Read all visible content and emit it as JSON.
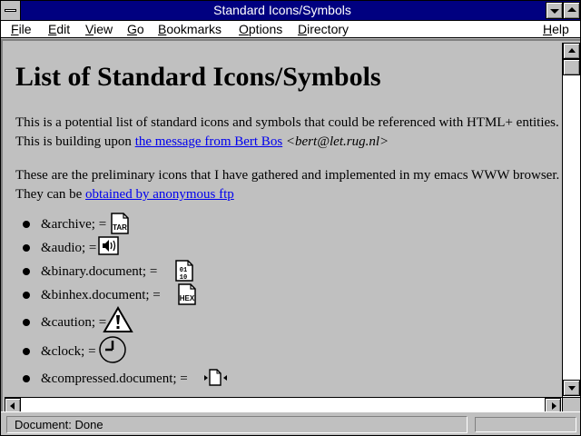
{
  "window": {
    "title": "Standard Icons/Symbols"
  },
  "menu": {
    "items": [
      {
        "label": "File",
        "key": "F",
        "rest": "ile"
      },
      {
        "label": "Edit",
        "key": "E",
        "rest": "dit"
      },
      {
        "label": "View",
        "key": "V",
        "rest": "iew"
      },
      {
        "label": "Go",
        "key": "G",
        "rest": "o"
      },
      {
        "label": "Bookmarks",
        "key": "B",
        "rest": "ookmarks"
      },
      {
        "label": "Options",
        "key": "O",
        "rest": "ptions"
      },
      {
        "label": "Directory",
        "key": "D",
        "rest": "irectory"
      },
      {
        "label": "Help",
        "key": "H",
        "rest": "elp"
      }
    ]
  },
  "page": {
    "heading": "List of Standard Icons/Symbols",
    "intro": {
      "text1": "This is a potential list of standard icons and symbols that could be referenced with HTML+ entities. This is building upon ",
      "link": "the message from Bert Bos",
      "email": "<bert@let.rug.nl>"
    },
    "prelim": {
      "text1": "These are the preliminary icons that I have gathered and implemented in my emacs WWW browser. They can be ",
      "link": "obtained by anonymous ftp"
    },
    "entities": [
      {
        "label": "&archive; =",
        "icon": "archive-icon",
        "icon_text": "TAR"
      },
      {
        "label": "&audio; =",
        "icon": "audio-icon"
      },
      {
        "label": "&binary.document; =",
        "icon": "binary-document-icon",
        "icon_text": "01 10"
      },
      {
        "label": "&binhex.document; =",
        "icon": "binhex-document-icon",
        "icon_text": "HEX"
      },
      {
        "label": "&caution; =",
        "icon": "caution-icon"
      },
      {
        "label": "&clock; =",
        "icon": "clock-icon"
      },
      {
        "label": "&compressed.document; =",
        "icon": "compressed-document-icon"
      }
    ]
  },
  "status": {
    "text": "Document: Done"
  }
}
